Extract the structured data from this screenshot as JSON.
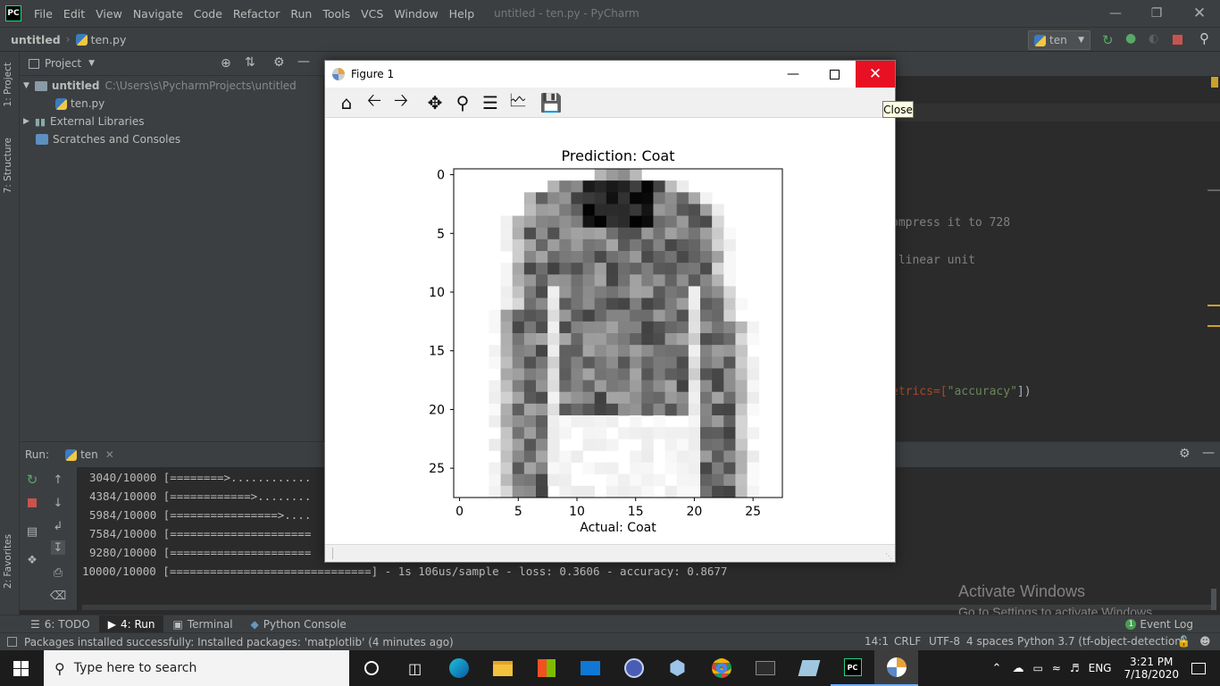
{
  "app": {
    "window_title": "untitled - ten.py - PyCharm",
    "logo_text": "PC"
  },
  "menu": [
    "File",
    "Edit",
    "View",
    "Navigate",
    "Code",
    "Refactor",
    "Run",
    "Tools",
    "VCS",
    "Window",
    "Help"
  ],
  "breadcrumb": {
    "project": "untitled",
    "file": "ten.py"
  },
  "run_config": {
    "name": "ten"
  },
  "left_strip": {
    "tab1": "1: Project",
    "tab2": "7: Structure",
    "tab3": "2: Favorites"
  },
  "project_panel": {
    "title": "Project",
    "root_name": "untitled",
    "root_path": "C:\\Users\\s\\PycharmProjects\\untitled",
    "file": "ten.py",
    "external": "External Libraries",
    "scratches": "Scratches and Consoles"
  },
  "editor": {
    "line1": "ompress it to 728",
    "line2": " linear unit",
    "line3a": "etrics=[",
    "line3b": "\"accuracy\"",
    "line3c": "])"
  },
  "run_panel": {
    "label": "Run:",
    "tab": "ten",
    "lines": [
      "3040/10000 [========>............",
      "4384/10000 [============>........",
      "5984/10000 [================>....",
      "7584/10000 [=====================",
      "9280/10000 [=====================",
      "10000/10000 [==============================] - 1s 106us/sample - loss: 0.3606 - accuracy: 0.8677"
    ]
  },
  "bottom_tabs": {
    "todo": "6: TODO",
    "run": "4: Run",
    "terminal": "Terminal",
    "python_console": "Python Console",
    "event_log": "Event Log",
    "event_count": "1"
  },
  "status": {
    "message": "Packages installed successfully: Installed packages: 'matplotlib' (4 minutes ago)",
    "position": "14:1",
    "line_sep": "CRLF",
    "encoding": "UTF-8",
    "indent": "4 spaces",
    "interpreter": "Python 3.7 (tf-object-detection)"
  },
  "watermark": {
    "line1": "Activate Windows",
    "line2": "Go to Settings to activate Windows."
  },
  "taskbar": {
    "search_placeholder": "Type here to search",
    "lang": "ENG",
    "time": "3:21 PM",
    "date": "7/18/2020"
  },
  "figure": {
    "window_title": "Figure 1",
    "tooltip": "Close",
    "plot_title": "Prediction: Coat",
    "xlabel": "Actual: Coat",
    "xticks": [
      "0",
      "5",
      "10",
      "15",
      "20",
      "25"
    ],
    "yticks": [
      "0",
      "5",
      "10",
      "15",
      "20",
      "25"
    ]
  },
  "chart_data": {
    "type": "heatmap",
    "title": "Prediction: Coat",
    "xlabel": "Actual: Coat",
    "ylabel": "",
    "xlim": [
      -0.5,
      27.5
    ],
    "ylim": [
      27.5,
      -0.5
    ],
    "xticks": [
      0,
      5,
      10,
      15,
      20,
      25
    ],
    "yticks": [
      0,
      5,
      10,
      15,
      20,
      25
    ],
    "colormap": "binary",
    "shape": [
      28,
      28
    ],
    "description_rows": "28x28 grayscale pixel intensities of a coat image (0=white, 1=black)"
  }
}
